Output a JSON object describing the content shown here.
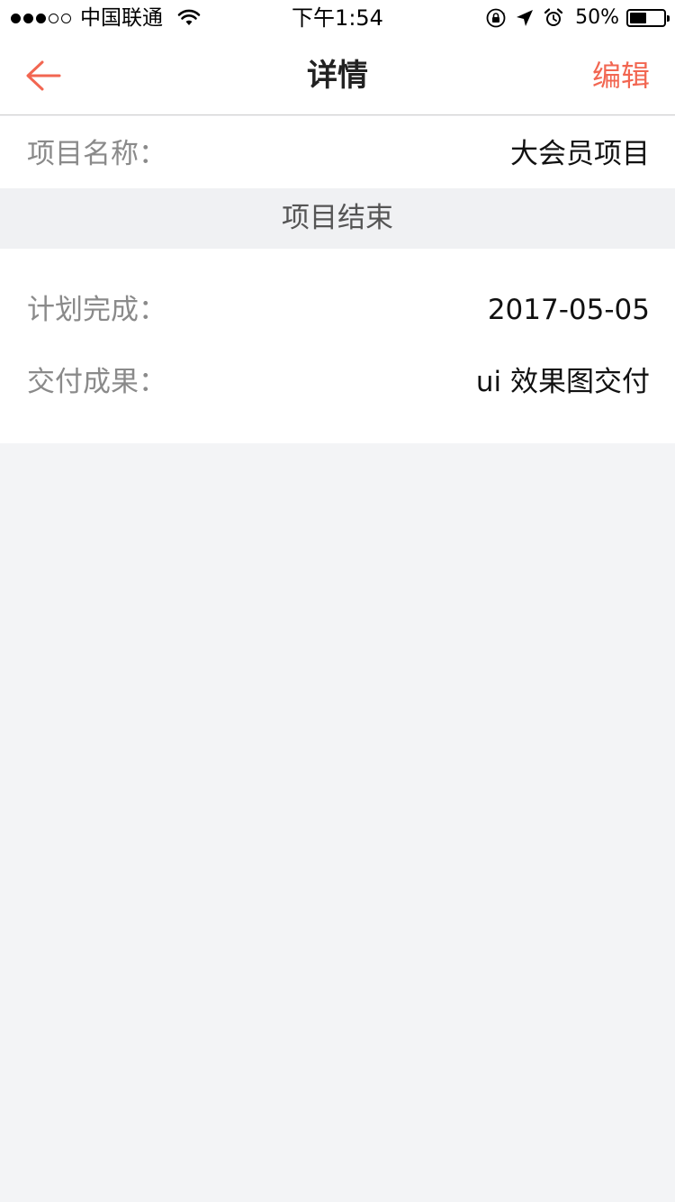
{
  "status_bar": {
    "signal_dots": 5,
    "signal_filled": 3,
    "carrier": "中国联通",
    "time": "下午1:54",
    "battery_percent": "50%",
    "battery_level": 0.5,
    "icons": [
      "wifi-icon",
      "rotation-lock-icon",
      "location-arrow-icon",
      "alarm-icon",
      "battery-icon"
    ]
  },
  "nav": {
    "title": "详情",
    "edit_label": "编辑",
    "back_icon": "back-arrow-icon",
    "accent_color": "#f26651"
  },
  "project": {
    "name_label": "项目名称：",
    "name_value": "大会员项目"
  },
  "section": {
    "title": "项目结束"
  },
  "details": {
    "plan_label": "计划完成：",
    "plan_value": "2017-05-05",
    "deliverable_label": "交付成果：",
    "deliverable_value": "ui 效果图交付"
  }
}
